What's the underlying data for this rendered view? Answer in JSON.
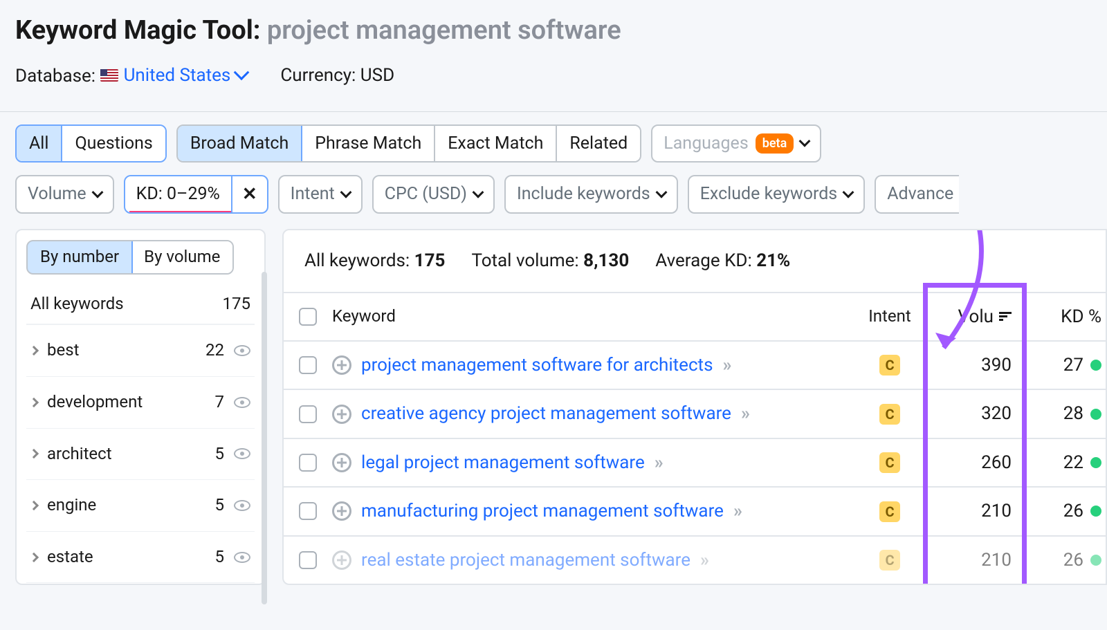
{
  "header": {
    "title_prefix": "Keyword Magic Tool: ",
    "query": "project management software",
    "database_label": "Database: ",
    "database_value": "United States",
    "currency_label": "Currency: ",
    "currency_value": "USD"
  },
  "filters": {
    "scope": {
      "items": [
        "All",
        "Questions"
      ],
      "active_index": 0
    },
    "match": {
      "items": [
        "Broad Match",
        "Phrase Match",
        "Exact Match",
        "Related"
      ],
      "active_index": 0
    },
    "languages_label": "Languages",
    "beta_label": "beta",
    "row2": {
      "volume": "Volume",
      "kd_chip": "KD: 0–29%",
      "intent": "Intent",
      "cpc": "CPC (USD)",
      "include": "Include keywords",
      "exclude": "Exclude keywords",
      "advanced": "Advance"
    }
  },
  "sidebar": {
    "tabs": [
      "By number",
      "By volume"
    ],
    "all_label": "All keywords",
    "all_count": "175",
    "groups": [
      {
        "label": "best",
        "count": "22"
      },
      {
        "label": "development",
        "count": "7"
      },
      {
        "label": "architect",
        "count": "5"
      },
      {
        "label": "engine",
        "count": "5"
      },
      {
        "label": "estate",
        "count": "5"
      }
    ]
  },
  "summary": {
    "all_kw_label": "All keywords: ",
    "all_kw_value": "175",
    "total_vol_label": "Total volume: ",
    "total_vol_value": "8,130",
    "avg_kd_label": "Average KD: ",
    "avg_kd_value": "21%"
  },
  "table": {
    "headers": {
      "keyword": "Keyword",
      "intent": "Intent",
      "volume": "Volu",
      "kd": "KD %"
    },
    "rows": [
      {
        "keyword": "project management software for architects",
        "intent": "C",
        "volume": "390",
        "kd": "27"
      },
      {
        "keyword": "creative agency project management software",
        "intent": "C",
        "volume": "320",
        "kd": "28"
      },
      {
        "keyword": "legal project management software",
        "intent": "C",
        "volume": "260",
        "kd": "22"
      },
      {
        "keyword": "manufacturing project management software",
        "intent": "C",
        "volume": "210",
        "kd": "26"
      },
      {
        "keyword": "real estate project management software",
        "intent": "C",
        "volume": "210",
        "kd": "26"
      }
    ]
  },
  "annotation": {
    "highlight_column": "volume"
  }
}
